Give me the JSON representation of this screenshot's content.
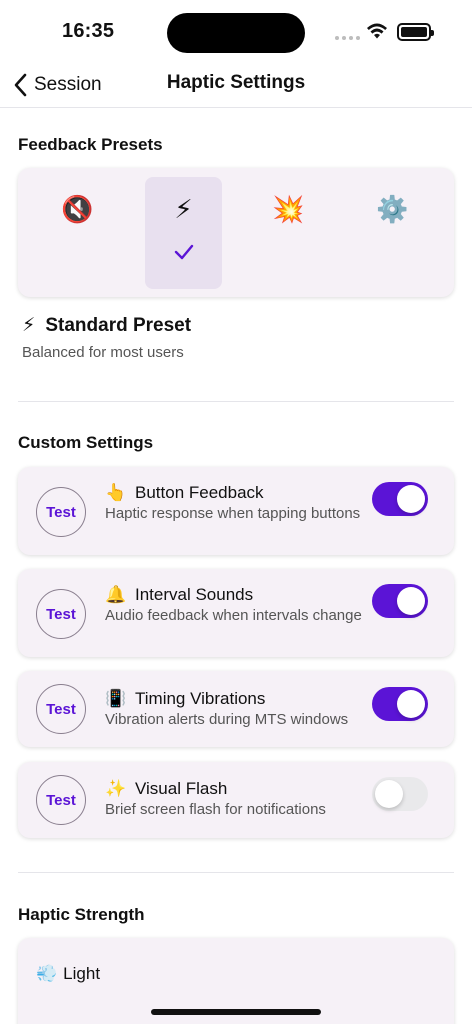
{
  "status": {
    "time": "16:35"
  },
  "nav": {
    "back_label": "Session",
    "title": "Haptic Settings"
  },
  "presets": {
    "section_title": "Feedback Presets",
    "items": [
      {
        "emoji": "🔇",
        "icon": "mute-icon",
        "selected": false
      },
      {
        "emoji": "⚡",
        "icon": "lightning-icon",
        "selected": true
      },
      {
        "emoji": "💥",
        "icon": "collision-icon",
        "selected": false
      },
      {
        "emoji": "⚙️",
        "icon": "gear-icon",
        "selected": false
      }
    ],
    "current_emoji": "⚡",
    "current_name": "Standard Preset",
    "current_desc": "Balanced for most users"
  },
  "custom": {
    "section_title": "Custom Settings",
    "items": [
      {
        "test_label": "Test",
        "emoji": "👆",
        "title": "Button Feedback",
        "desc": "Haptic response when tapping buttons",
        "on": true
      },
      {
        "test_label": "Test",
        "emoji": "🔔",
        "title": "Interval Sounds",
        "desc": "Audio feedback when intervals change",
        "on": true
      },
      {
        "test_label": "Test",
        "emoji": "📳",
        "title": "Timing Vibrations",
        "desc": "Vibration alerts during MTS windows",
        "on": true
      },
      {
        "test_label": "Test",
        "emoji": "✨",
        "title": "Visual Flash",
        "desc": "Brief screen flash for notifications",
        "on": false
      }
    ]
  },
  "strength": {
    "section_title": "Haptic Strength",
    "options": [
      {
        "emoji": "💨",
        "label": "Light"
      }
    ]
  },
  "colors": {
    "accent": "#5b14d6",
    "card": "#f6f1f7",
    "selected": "#e8e0ef"
  }
}
